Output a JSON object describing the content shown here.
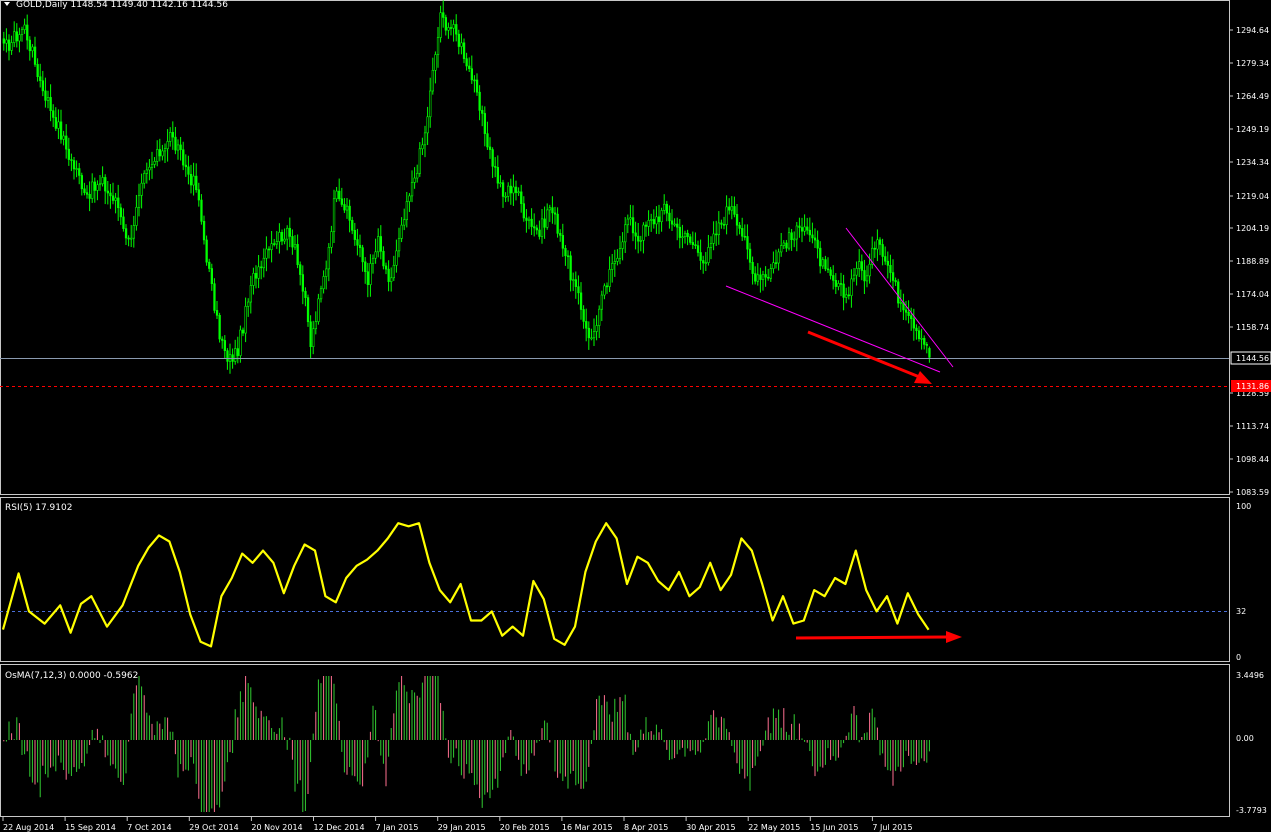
{
  "colors": {
    "background": "#000000",
    "frame": "#c8c8c8",
    "candle": "#00ff00",
    "rsi_line": "#ffff00",
    "osma_up": "#32cd32",
    "osma_down": "#ff6f91",
    "trendline": "#ff00ff",
    "arrow": "#ff0000",
    "bid_line": "#8a9ab0",
    "target_line": "#ff0000",
    "text": "#ffffff"
  },
  "price_panel": {
    "header": "GOLD,Daily  1148.54 1149.40 1142.16 1144.56",
    "y_ticks": [
      "1294.64",
      "1279.34",
      "1264.49",
      "1249.19",
      "1234.34",
      "1219.04",
      "1204.19",
      "1188.89",
      "1174.04",
      "1158.74",
      "1128.59",
      "1113.74",
      "1098.44",
      "1083.59"
    ],
    "current_price_label": "1144.56",
    "target_price_label": "1131.86"
  },
  "rsi_panel": {
    "header": "RSI(5) 17.9102",
    "y_ticks": [
      "100",
      "32",
      "0"
    ]
  },
  "osma_panel": {
    "header": "OsMA(7,12,3) 0.0000 -0.5962",
    "y_ticks": [
      "3.4496",
      "0.00",
      "-3.7793"
    ]
  },
  "x_ticks": [
    "22 Aug 2014",
    "15 Sep 2014",
    "7 Oct 2014",
    "29 Oct 2014",
    "20 Nov 2014",
    "12 Dec 2014",
    "7 Jan 2015",
    "29 Jan 2015",
    "20 Feb 2015",
    "16 Mar 2015",
    "8 Apr 2015",
    "30 Apr 2015",
    "22 May 2015",
    "15 Jun 2015",
    "7 Jul 2015"
  ],
  "chart_data": [
    {
      "type": "candlestick",
      "title": "GOLD,Daily",
      "ylim": [
        1083.59,
        1304
      ],
      "last_bar": {
        "open": 1148.54,
        "high": 1149.4,
        "low": 1142.16,
        "close": 1144.56
      },
      "levels": [
        {
          "value": 1144.56,
          "style": "solid"
        },
        {
          "value": 1131.86,
          "style": "dashed"
        }
      ],
      "close_path": [
        [
          0,
          1282
        ],
        [
          8,
          1292
        ],
        [
          14,
          1268
        ],
        [
          20,
          1250
        ],
        [
          26,
          1232
        ],
        [
          32,
          1218
        ],
        [
          38,
          1222
        ],
        [
          44,
          1212
        ],
        [
          48,
          1196
        ],
        [
          54,
          1224
        ],
        [
          60,
          1236
        ],
        [
          64,
          1244
        ],
        [
          68,
          1234
        ],
        [
          74,
          1220
        ],
        [
          78,
          1190
        ],
        [
          82,
          1160
        ],
        [
          86,
          1142
        ],
        [
          90,
          1148
        ],
        [
          96,
          1180
        ],
        [
          102,
          1196
        ],
        [
          108,
          1200
        ],
        [
          112,
          1196
        ],
        [
          116,
          1168
        ],
        [
          118,
          1150
        ],
        [
          124,
          1186
        ],
        [
          128,
          1222
        ],
        [
          134,
          1202
        ],
        [
          140,
          1180
        ],
        [
          144,
          1196
        ],
        [
          148,
          1176
        ],
        [
          152,
          1196
        ],
        [
          156,
          1216
        ],
        [
          162,
          1244
        ],
        [
          166,
          1280
        ],
        [
          168,
          1296
        ],
        [
          172,
          1292
        ],
        [
          176,
          1284
        ],
        [
          180,
          1270
        ],
        [
          184,
          1250
        ],
        [
          188,
          1232
        ],
        [
          192,
          1216
        ],
        [
          196,
          1222
        ],
        [
          200,
          1210
        ],
        [
          206,
          1200
        ],
        [
          210,
          1212
        ],
        [
          214,
          1200
        ],
        [
          218,
          1182
        ],
        [
          222,
          1166
        ],
        [
          226,
          1152
        ],
        [
          230,
          1170
        ],
        [
          236,
          1192
        ],
        [
          240,
          1206
        ],
        [
          244,
          1198
        ],
        [
          248,
          1204
        ],
        [
          254,
          1210
        ],
        [
          258,
          1204
        ],
        [
          262,
          1198
        ],
        [
          266,
          1194
        ],
        [
          270,
          1188
        ],
        [
          274,
          1200
        ],
        [
          280,
          1214
        ],
        [
          284,
          1200
        ],
        [
          288,
          1182
        ],
        [
          294,
          1182
        ],
        [
          300,
          1196
        ],
        [
          304,
          1198
        ],
        [
          308,
          1206
        ],
        [
          312,
          1194
        ],
        [
          316,
          1182
        ],
        [
          320,
          1176
        ],
        [
          324,
          1172
        ],
        [
          328,
          1186
        ],
        [
          332,
          1180
        ],
        [
          336,
          1200
        ],
        [
          340,
          1186
        ],
        [
          344,
          1172
        ],
        [
          348,
          1166
        ],
        [
          351,
          1158
        ],
        [
          354,
          1152
        ],
        [
          356,
          1144.56
        ]
      ]
    },
    {
      "type": "line",
      "title": "RSI(5)",
      "ylim": [
        0,
        100
      ],
      "levels": [
        32
      ],
      "points": [
        [
          0,
          18
        ],
        [
          6,
          55
        ],
        [
          10,
          30
        ],
        [
          16,
          22
        ],
        [
          22,
          34
        ],
        [
          26,
          16
        ],
        [
          30,
          35
        ],
        [
          34,
          40
        ],
        [
          40,
          20
        ],
        [
          46,
          34
        ],
        [
          52,
          60
        ],
        [
          56,
          72
        ],
        [
          60,
          80
        ],
        [
          64,
          76
        ],
        [
          68,
          56
        ],
        [
          72,
          28
        ],
        [
          76,
          10
        ],
        [
          80,
          7
        ],
        [
          84,
          40
        ],
        [
          88,
          52
        ],
        [
          92,
          68
        ],
        [
          96,
          62
        ],
        [
          100,
          70
        ],
        [
          104,
          62
        ],
        [
          108,
          42
        ],
        [
          112,
          60
        ],
        [
          116,
          74
        ],
        [
          120,
          70
        ],
        [
          124,
          40
        ],
        [
          128,
          36
        ],
        [
          132,
          52
        ],
        [
          136,
          60
        ],
        [
          140,
          64
        ],
        [
          144,
          70
        ],
        [
          148,
          78
        ],
        [
          152,
          88
        ],
        [
          156,
          86
        ],
        [
          160,
          88
        ],
        [
          164,
          62
        ],
        [
          168,
          44
        ],
        [
          172,
          36
        ],
        [
          176,
          48
        ],
        [
          180,
          24
        ],
        [
          184,
          24
        ],
        [
          188,
          30
        ],
        [
          192,
          14
        ],
        [
          196,
          20
        ],
        [
          200,
          14
        ],
        [
          204,
          50
        ],
        [
          208,
          38
        ],
        [
          212,
          12
        ],
        [
          216,
          8
        ],
        [
          220,
          20
        ],
        [
          224,
          56
        ],
        [
          228,
          76
        ],
        [
          232,
          88
        ],
        [
          236,
          78
        ],
        [
          240,
          48
        ],
        [
          244,
          66
        ],
        [
          248,
          62
        ],
        [
          252,
          50
        ],
        [
          256,
          44
        ],
        [
          260,
          56
        ],
        [
          264,
          40
        ],
        [
          268,
          46
        ],
        [
          272,
          62
        ],
        [
          276,
          44
        ],
        [
          280,
          54
        ],
        [
          284,
          78
        ],
        [
          288,
          70
        ],
        [
          292,
          48
        ],
        [
          296,
          24
        ],
        [
          300,
          40
        ],
        [
          304,
          22
        ],
        [
          308,
          24
        ],
        [
          312,
          44
        ],
        [
          316,
          40
        ],
        [
          320,
          52
        ],
        [
          324,
          48
        ],
        [
          328,
          70
        ],
        [
          332,
          44
        ],
        [
          336,
          30
        ],
        [
          340,
          40
        ],
        [
          344,
          22
        ],
        [
          348,
          42
        ],
        [
          352,
          28
        ],
        [
          356,
          17.91
        ]
      ]
    },
    {
      "type": "bar",
      "title": "OsMA(7,12,3)",
      "ylim": [
        -3.7793,
        3.4496
      ],
      "last_value": -0.5962,
      "bars_per_day": 1
    }
  ]
}
